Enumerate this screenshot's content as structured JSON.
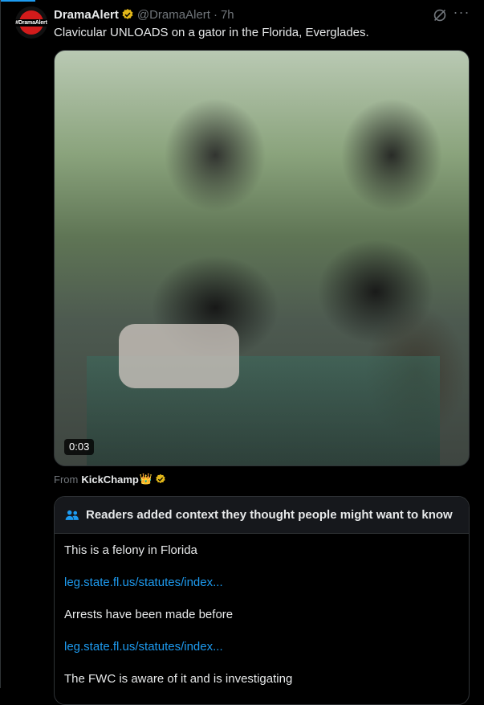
{
  "tweet": {
    "display_name": "DramaAlert",
    "handle": "@DramaAlert",
    "separator": "·",
    "time": "7h",
    "text": "Clavicular UNLOADS on a gator in the Florida, Everglades.",
    "avatar_text": "#DramaAlert",
    "more_label": "···"
  },
  "media": {
    "duration": "0:03"
  },
  "source": {
    "from_label": "From",
    "account": "KickChamp",
    "account_emoji": "👑"
  },
  "community_notes": {
    "header": "Readers added context they thought people might want to know",
    "items": [
      {
        "text": "This is a felony in Florida"
      },
      {
        "link": "leg.state.fl.us/statutes/index..."
      },
      {
        "text": "Arrests have been made before"
      },
      {
        "link": "leg.state.fl.us/statutes/index..."
      },
      {
        "text": "The FWC is aware of it and is investigating"
      }
    ]
  },
  "colors": {
    "background": "#000000",
    "text_primary": "#e7e9ea",
    "text_secondary": "#71767b",
    "link": "#1d9bf0",
    "verified_gold": "#e2b719",
    "border": "#2f3336"
  },
  "icons": [
    "verified-gold-badge-icon",
    "grok-icon",
    "more-icon",
    "people-icon"
  ]
}
